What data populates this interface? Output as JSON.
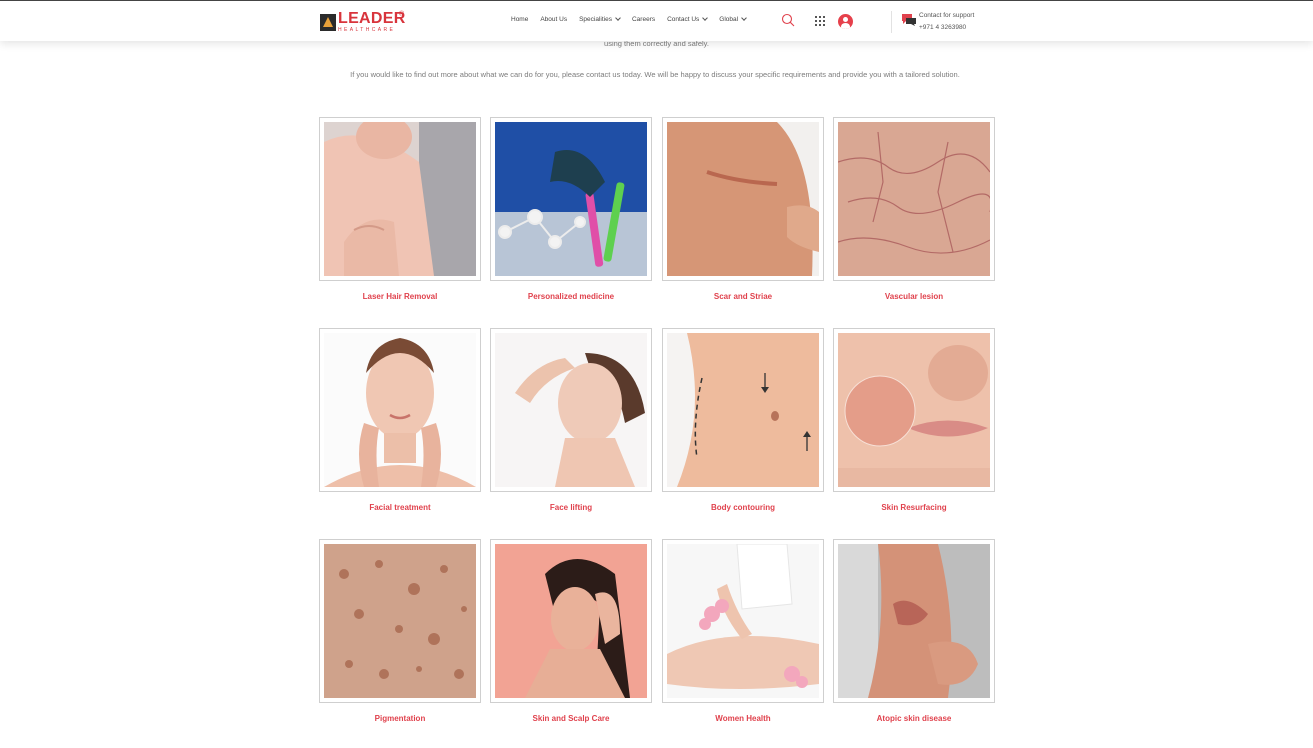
{
  "brand": {
    "name": "LEADER",
    "tagline": "HEALTHCARE",
    "mark": "®"
  },
  "nav": {
    "items": [
      {
        "label": "Home",
        "dropdown": false
      },
      {
        "label": "About Us",
        "dropdown": false
      },
      {
        "label": "Specialities",
        "dropdown": true
      },
      {
        "label": "Careers",
        "dropdown": false
      },
      {
        "label": "Contact Us",
        "dropdown": true
      },
      {
        "label": "Global",
        "dropdown": true
      }
    ]
  },
  "icons": {
    "search": "search-icon",
    "apps": "grid-icon",
    "user": "user-icon",
    "support": "chat-icon"
  },
  "support": {
    "label": "Contact for support",
    "phone": "+971 4 3263980"
  },
  "intro": {
    "tail": "using them correctly and safely.",
    "paragraph": "If you would like to find out more about what we can do for you, please contact us today. We will be happy to discuss your specific requirements and provide you with a tailored solution."
  },
  "accent": "#e0424d",
  "services": [
    {
      "label": "Laser Hair Removal"
    },
    {
      "label": "Personalized medicine"
    },
    {
      "label": "Scar and Striae"
    },
    {
      "label": "Vascular lesion"
    },
    {
      "label": "Facial treatment"
    },
    {
      "label": "Face lifting"
    },
    {
      "label": "Body contouring"
    },
    {
      "label": "Skin Resurfacing"
    },
    {
      "label": "Pigmentation"
    },
    {
      "label": "Skin and Scalp Care"
    },
    {
      "label": "Women Health"
    },
    {
      "label": "Atopic skin disease"
    }
  ]
}
